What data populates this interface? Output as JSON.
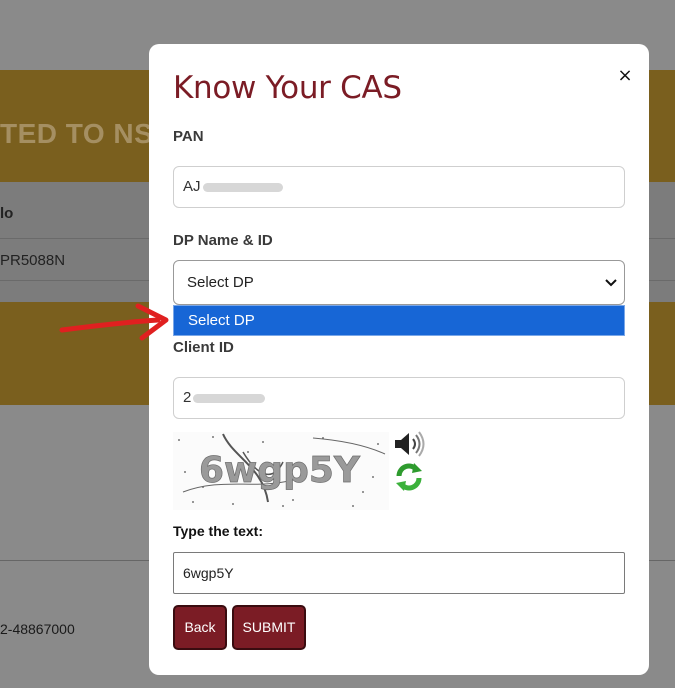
{
  "background": {
    "banner_text": "TED TO NSD",
    "column_header": "lo",
    "cell_value": "PR5088N",
    "phone_text": "2-48867000"
  },
  "modal": {
    "title": "Know Your CAS",
    "close_label": "×",
    "pan": {
      "label": "PAN",
      "value": "AJ"
    },
    "dp": {
      "label": "DP Name & ID",
      "selected": "Select DP",
      "options": [
        "Select DP"
      ]
    },
    "client_id": {
      "label": "Client ID",
      "value": "2"
    },
    "captcha": {
      "image_text": "6wgp5Y",
      "audio_icon": "speaker-icon",
      "refresh_icon": "refresh-icon"
    },
    "type_text": {
      "label": "Type the text:",
      "value": "6wgp5Y"
    },
    "buttons": {
      "back": "Back",
      "submit": "SUBMIT"
    }
  },
  "colors": {
    "accent": "#7b1c25",
    "selected_option": "#1766d6",
    "annotation_arrow": "#e02020"
  }
}
